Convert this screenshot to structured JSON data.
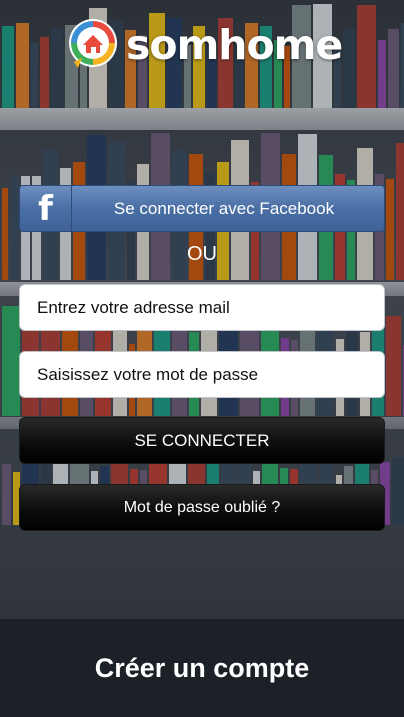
{
  "brand": {
    "name": "somhome"
  },
  "facebook": {
    "icon": "facebook-f-icon",
    "label": "Se connecter avec Facebook",
    "color": "#4a6fa5"
  },
  "separator": "OU",
  "form": {
    "email_placeholder": "Entrez votre adresse mail",
    "email_value": "",
    "password_placeholder": "Saisissez votre mot de passe",
    "password_value": ""
  },
  "actions": {
    "login_label": "SE CONNECTER",
    "forgot_label": "Mot de passe oublié ?"
  },
  "footer": {
    "create_account_label": "Créer un compte"
  }
}
